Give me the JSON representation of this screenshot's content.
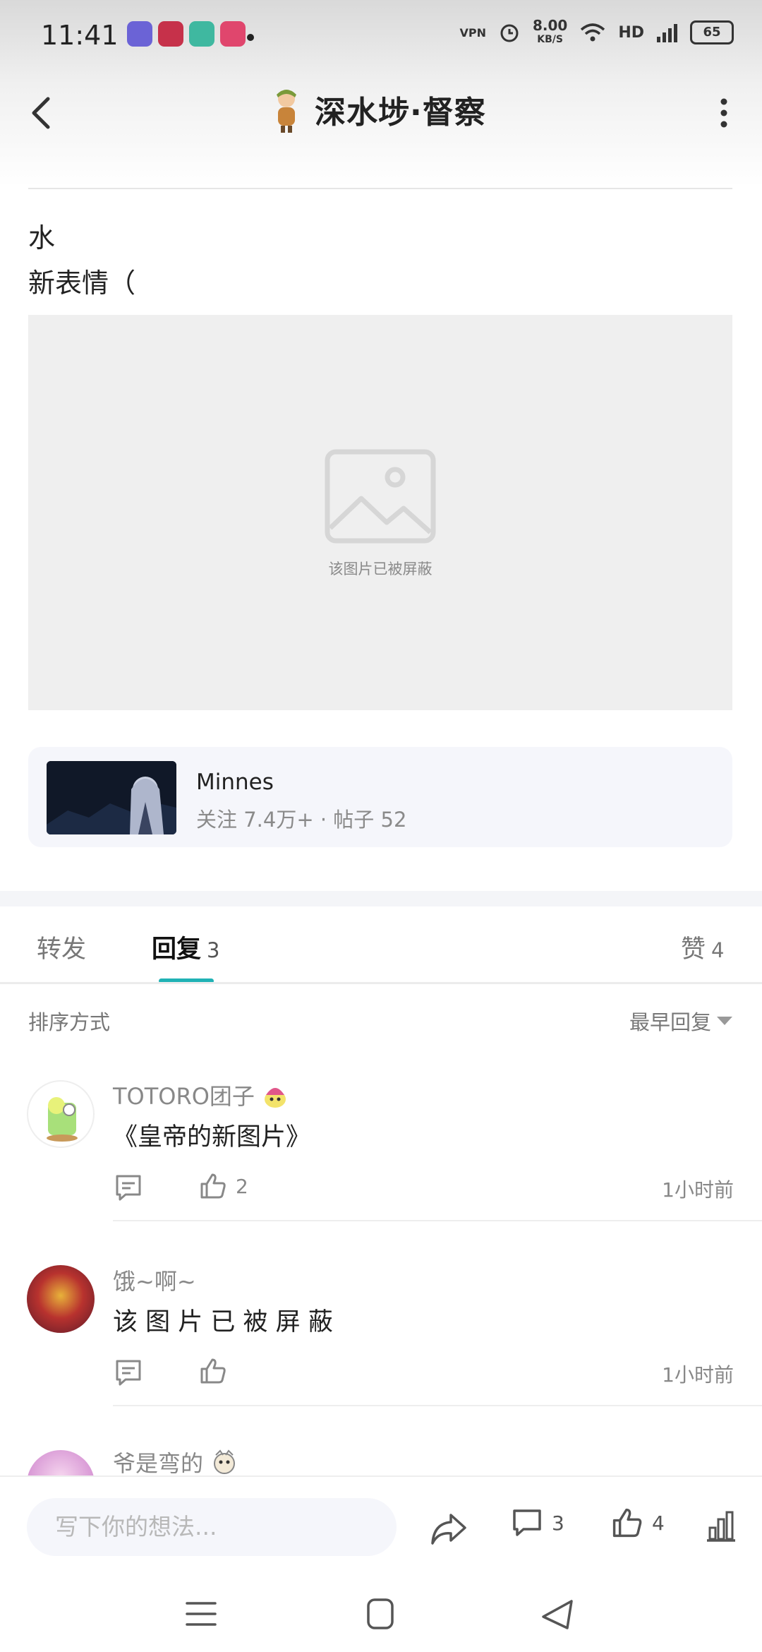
{
  "status_bar": {
    "time": "11:41",
    "speed_value": "8.00",
    "speed_unit": "KB/S",
    "vpn": "VPN",
    "hd": "HD",
    "battery": "65"
  },
  "header": {
    "title": "深水埗·督察"
  },
  "post": {
    "lines": [
      "水",
      "新表情（"
    ],
    "blocked_image_label": "该图片已被屏蔽"
  },
  "forum_card": {
    "name": "Minnes",
    "stats": "关注 7.4万+ · 帖子 52"
  },
  "tabs": {
    "forward": "转发",
    "reply": "回复",
    "reply_count": "3",
    "like": "赞",
    "like_count": "4"
  },
  "sort": {
    "label": "排序方式",
    "value": "最早回复"
  },
  "replies": [
    {
      "name": "TOTORO团子",
      "content": "《皇帝的新图片》",
      "likes": "2",
      "time": "1小时前"
    },
    {
      "name": "饿~啊~",
      "content": "该 图 片 已 被 屏 蔽",
      "likes": "",
      "time": "1小时前"
    },
    {
      "name": "爷是弯的",
      "content": "",
      "likes": "",
      "time": ""
    }
  ],
  "bottom_bar": {
    "input_placeholder": "写下你的想法...",
    "comment_count": "3",
    "like_count": "4"
  },
  "colors": {
    "accent": "#20b2b5",
    "card_bg": "#f5f6fb",
    "blocked_bg": "#efefef"
  }
}
